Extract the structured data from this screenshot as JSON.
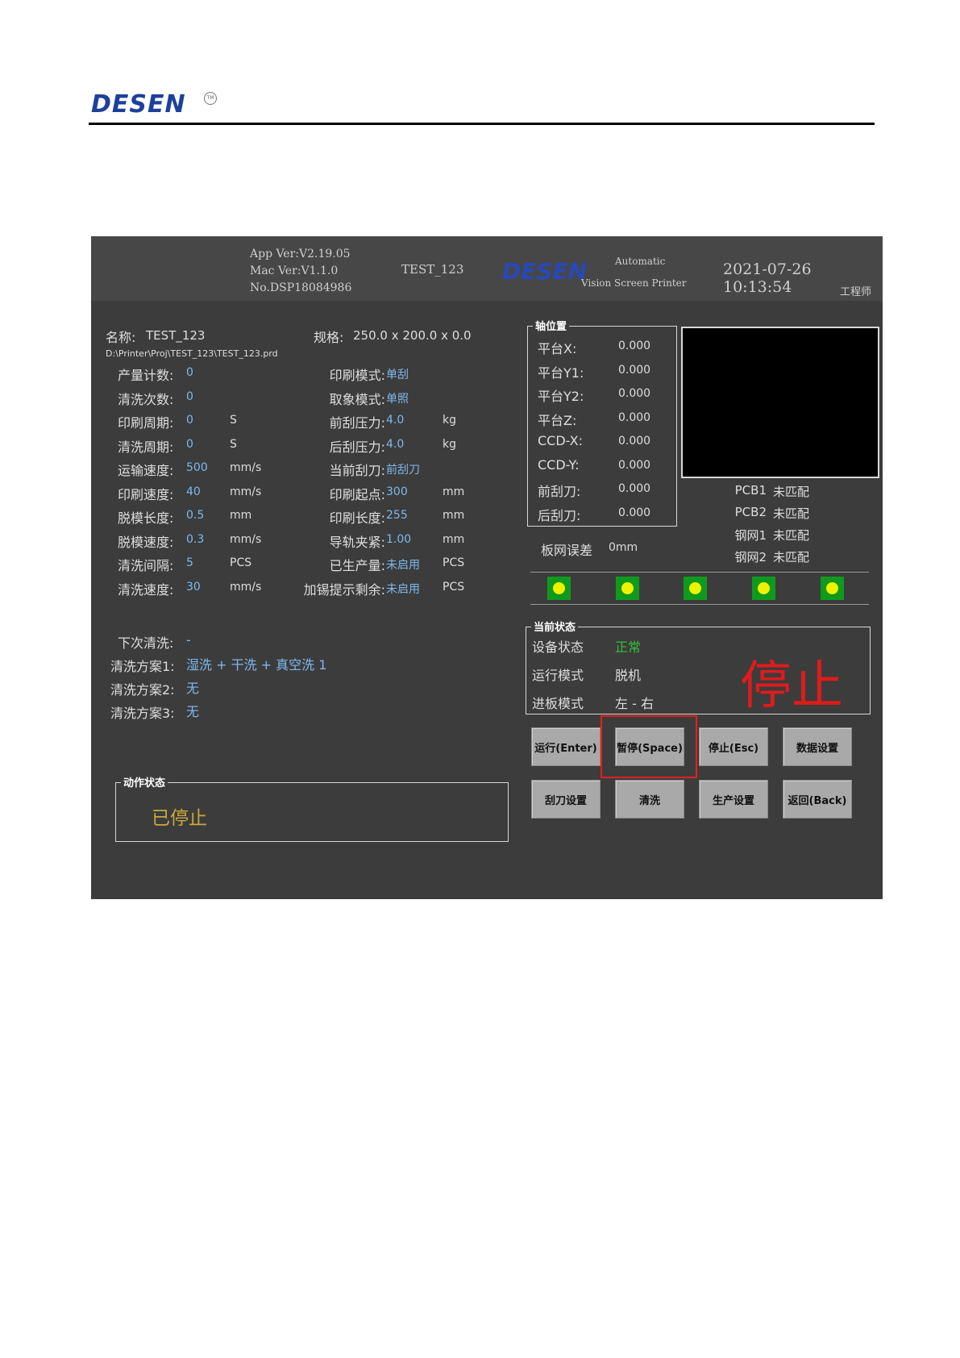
{
  "document": {
    "logo_text": "DESEN",
    "logo_mark": "TM"
  },
  "titlebar": {
    "app_ver": "App Ver:V2.19.05",
    "mac_ver": "Mac Ver:V1.1.0",
    "serial_no": "No.DSP18084986",
    "project": "TEST_123",
    "logo_text": "DESEN",
    "product_line1": "Automatic",
    "product_line2": "Vision Screen Printer",
    "datetime": "2021-07-26 10:13:54",
    "user_role": "工程师"
  },
  "project": {
    "name_label": "名称:",
    "name": "TEST_123",
    "spec_label": "规格:",
    "spec": "250.0 x 200.0 x 0.0",
    "path": "D:\\Printer\\Proj\\TEST_123\\TEST_123.prd"
  },
  "params_left": [
    {
      "label": "产量计数:",
      "value": "0",
      "unit": ""
    },
    {
      "label": "清洗次数:",
      "value": "0",
      "unit": ""
    },
    {
      "label": "印刷周期:",
      "value": "0",
      "unit": "S"
    },
    {
      "label": "清洗周期:",
      "value": "0",
      "unit": "S"
    },
    {
      "label": "运输速度:",
      "value": "500",
      "unit": "mm/s"
    },
    {
      "label": "印刷速度:",
      "value": "40",
      "unit": "mm/s"
    },
    {
      "label": "脱模长度:",
      "value": "0.5",
      "unit": "mm"
    },
    {
      "label": "脱模速度:",
      "value": "0.3",
      "unit": "mm/s"
    },
    {
      "label": "清洗间隔:",
      "value": "5",
      "unit": "PCS"
    },
    {
      "label": "清洗速度:",
      "value": "30",
      "unit": "mm/s"
    }
  ],
  "params_right": [
    {
      "label": "印刷模式:",
      "value": "单刮",
      "unit": ""
    },
    {
      "label": "取象模式:",
      "value": "单照",
      "unit": ""
    },
    {
      "label": "前刮压力:",
      "value": "4.0",
      "unit": "kg"
    },
    {
      "label": "后刮压力:",
      "value": "4.0",
      "unit": "kg"
    },
    {
      "label": "当前刮刀:",
      "value": "前刮刀",
      "unit": ""
    },
    {
      "label": "印刷起点:",
      "value": "300",
      "unit": "mm"
    },
    {
      "label": "印刷长度:",
      "value": "255",
      "unit": "mm"
    },
    {
      "label": "导轨夹紧:",
      "value": "1.00",
      "unit": "mm"
    },
    {
      "label": "已生产量:",
      "value": "未启用",
      "unit": "PCS"
    },
    {
      "label": "加锡提示剩余:",
      "value": "未启用",
      "unit": "PCS"
    }
  ],
  "cleaning": {
    "next_label": "下次清洗:",
    "next_value": "-",
    "plan1_label": "清洗方案1:",
    "plan1_value": "湿洗 + 干洗 + 真空洗  1",
    "plan2_label": "清洗方案2:",
    "plan2_value": "无",
    "plan3_label": "清洗方案3:",
    "plan3_value": "无"
  },
  "action_status": {
    "title": "动作状态",
    "value": "已停止"
  },
  "axis": {
    "title": "轴位置",
    "items": [
      {
        "label": "平台X:",
        "value": "0.000"
      },
      {
        "label": "平台Y1:",
        "value": "0.000"
      },
      {
        "label": "平台Y2:",
        "value": "0.000"
      },
      {
        "label": "平台Z:",
        "value": "0.000"
      },
      {
        "label": "CCD-X:",
        "value": "0.000"
      },
      {
        "label": "CCD-Y:",
        "value": "0.000"
      },
      {
        "label": "前刮刀:",
        "value": "0.000"
      },
      {
        "label": "后刮刀:",
        "value": "0.000"
      }
    ]
  },
  "match": [
    {
      "label": "PCB1",
      "value": "未匹配"
    },
    {
      "label": "PCB2",
      "value": "未匹配"
    },
    {
      "label": "钢网1",
      "value": "未匹配"
    },
    {
      "label": "钢网2",
      "value": "未匹配"
    }
  ],
  "board_error": {
    "label": "板网误差",
    "value": "0mm"
  },
  "indicator_color": "#0f9a1e",
  "indicator_lamp_color": "#eef200",
  "current_status": {
    "title": "当前状态",
    "device_label": "设备状态",
    "device_value": "正常",
    "run_mode_label": "运行模式",
    "run_mode_value": "脱机",
    "feed_mode_label": "进板模式",
    "feed_mode_value": "左 - 右",
    "big_state": "停止",
    "big_state_color": "#dd1c1c"
  },
  "buttons": {
    "run": "运行(Enter)",
    "pause": "暂停(Space)",
    "stop": "停止(Esc)",
    "data_settings": "数据设置",
    "squeegee_settings": "刮刀设置",
    "clean": "清洗",
    "production_settings": "生产设置",
    "back": "返回(Back)"
  }
}
